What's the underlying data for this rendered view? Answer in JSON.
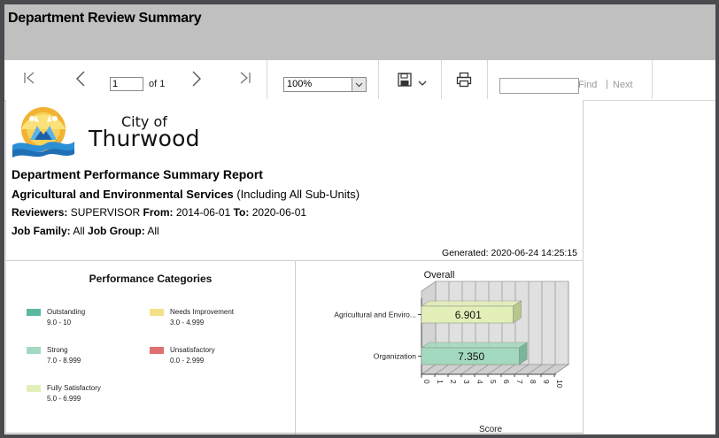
{
  "window": {
    "title": "Department Review Summary"
  },
  "toolbar": {
    "page_value": "1",
    "page_of": "of 1",
    "zoom": "100%",
    "find_placeholder": "",
    "find_label": "Find",
    "find_sep": "|",
    "next_label": "Next",
    "icons": [
      "first-page-icon",
      "previous-page-icon",
      "next-page-icon",
      "last-page-icon",
      "save-icon",
      "chevron-down-icon",
      "print-icon"
    ]
  },
  "report": {
    "logo": {
      "line1": "City of",
      "line2": "Thurwood"
    },
    "title": "Department Performance Summary Report",
    "department_name": "Agricultural and Environmental Services",
    "department_suffix": "(Including All Sub-Units)",
    "reviewers_label": "Reviewers:",
    "reviewers_value": "SUPERVISOR",
    "from_label": "From:",
    "from_value": "2014-06-01",
    "to_label": "To:",
    "to_value": "2020-06-01",
    "job_family_label": "Job Family:",
    "job_family_value": "All",
    "job_group_label": "Job Group:",
    "job_group_value": "All",
    "generated": "Generated: 2020-06-24 14:25:15"
  },
  "categories": {
    "title": "Performance Categories",
    "items": [
      {
        "name": "Outstanding",
        "range": "9.0 - 10",
        "color": "#5bb8a0"
      },
      {
        "name": "Needs Improvement",
        "range": "3.0 - 4.999",
        "color": "#f5e08a"
      },
      {
        "name": "Strong",
        "range": "7.0 - 8.999",
        "color": "#a3d9c0"
      },
      {
        "name": "Unsatisfactory",
        "range": "0.0 - 2.999",
        "color": "#e07070"
      },
      {
        "name": "Fully Satisfactory",
        "range": "5.0 - 6.999",
        "color": "#e3efb9"
      }
    ]
  },
  "chart_data": {
    "type": "bar",
    "orientation": "horizontal",
    "title": "Overall",
    "xlabel": "Score",
    "ylabel": "",
    "categories": [
      "Agricultural and Enviro...",
      "Organization"
    ],
    "values": [
      6.901,
      7.35
    ],
    "value_labels": [
      "6.901",
      "7.350"
    ],
    "bar_colors": [
      "#e3efb9",
      "#a3d9c0"
    ],
    "xlim": [
      0,
      10
    ],
    "x_ticks": [
      0,
      1,
      2,
      3,
      4,
      5,
      6,
      7,
      8,
      9,
      10
    ],
    "grid": true,
    "style": "3d"
  }
}
